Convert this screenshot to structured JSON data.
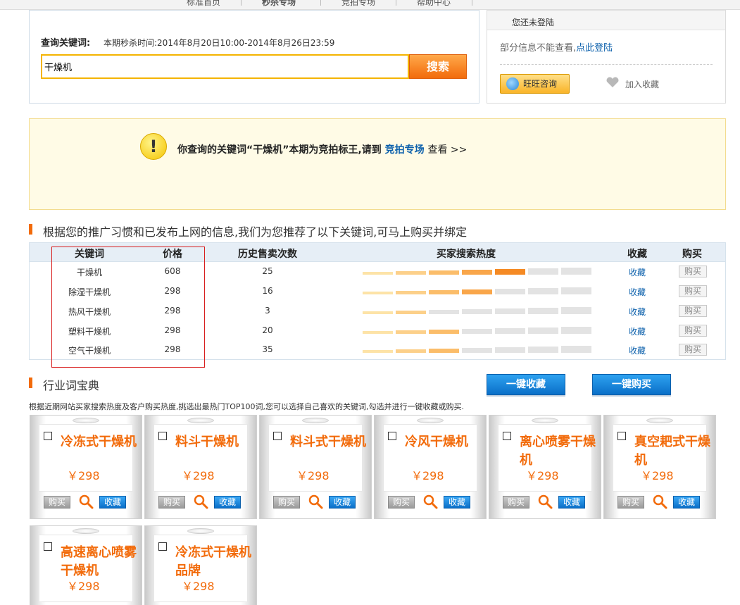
{
  "nav": {
    "items": [
      "标准首页",
      "秒杀专场",
      "竞拍专场",
      "帮助中心"
    ]
  },
  "search": {
    "label": "查询关键词:",
    "period": "本期秒杀时间:2014年8月20日10:00-2014年8月26日23:59",
    "value": "干燥机",
    "button": "搜索"
  },
  "login": {
    "title": "您还未登陆",
    "message": "部分信息不能查看,",
    "link": "点此登陆",
    "wangwang": "旺旺咨询",
    "favorite": "加入收藏"
  },
  "notice": {
    "text": "你查询的关键词“干燥机”本期为竞拍标王,请到",
    "link": "竞拍专场",
    "tail": "查看 >>"
  },
  "recommend": {
    "title": "根据您的推广习惯和已发布上网的信息,我们为您推荐了以下关键词,可马上购买并绑定",
    "headers": {
      "keyword": "关键词",
      "price": "价格",
      "history": "历史售卖次数",
      "heat": "买家搜索热度",
      "favorite": "收藏",
      "buy": "购买"
    },
    "rows": [
      {
        "keyword": "干燥机",
        "price": "608",
        "history": "25",
        "heat": 5,
        "favorite": "收藏",
        "buy": "购买"
      },
      {
        "keyword": "除湿干燥机",
        "price": "298",
        "history": "16",
        "heat": 4,
        "favorite": "收藏",
        "buy": "购买"
      },
      {
        "keyword": "热风干燥机",
        "price": "298",
        "history": "3",
        "heat": 2,
        "favorite": "收藏",
        "buy": "购买"
      },
      {
        "keyword": "塑料干燥机",
        "price": "298",
        "history": "20",
        "heat": 3,
        "favorite": "收藏",
        "buy": "购买"
      },
      {
        "keyword": "空气干燥机",
        "price": "298",
        "history": "35",
        "heat": 3,
        "favorite": "收藏",
        "buy": "购买"
      }
    ],
    "heat_max": 7
  },
  "industry": {
    "title": "行业词宝典",
    "fav_all": "一键收藏",
    "buy_all": "一键购买",
    "desc": "根据近期网站买家搜索热度及客户购买热度,挑选出最热门TOP100词,您可以选择自己喜欢的关键词,勾选并进行一键收藏或购买.",
    "cards": [
      {
        "name": "冷冻式干燥机",
        "price": "￥298",
        "buy": "购买",
        "fav": "收藏"
      },
      {
        "name": "料斗干燥机",
        "price": "￥298",
        "buy": "购买",
        "fav": "收藏"
      },
      {
        "name": "料斗式干燥机",
        "price": "￥298",
        "buy": "购买",
        "fav": "收藏"
      },
      {
        "name": "冷风干燥机",
        "price": "￥298",
        "buy": "购买",
        "fav": "收藏"
      },
      {
        "name": "离心喷雾干燥机",
        "price": "￥298",
        "buy": "购买",
        "fav": "收藏"
      },
      {
        "name": "真空耙式干燥机",
        "price": "￥298",
        "buy": "购买",
        "fav": "收藏"
      },
      {
        "name": "高速离心喷雾干燥机",
        "price": "￥298",
        "buy": "购买",
        "fav": "收藏"
      },
      {
        "name": "冷冻式干燥机品牌",
        "price": "￥298",
        "buy": "购买",
        "fav": "收藏"
      }
    ]
  },
  "colors": {
    "accent": "#f26b0b",
    "link": "#0a5fab",
    "heat_levels": [
      "#fde3a7",
      "#fcd08a",
      "#fbbd6a",
      "#f9a64a",
      "#f58a24"
    ],
    "heat_empty": "#e3e3e3"
  }
}
